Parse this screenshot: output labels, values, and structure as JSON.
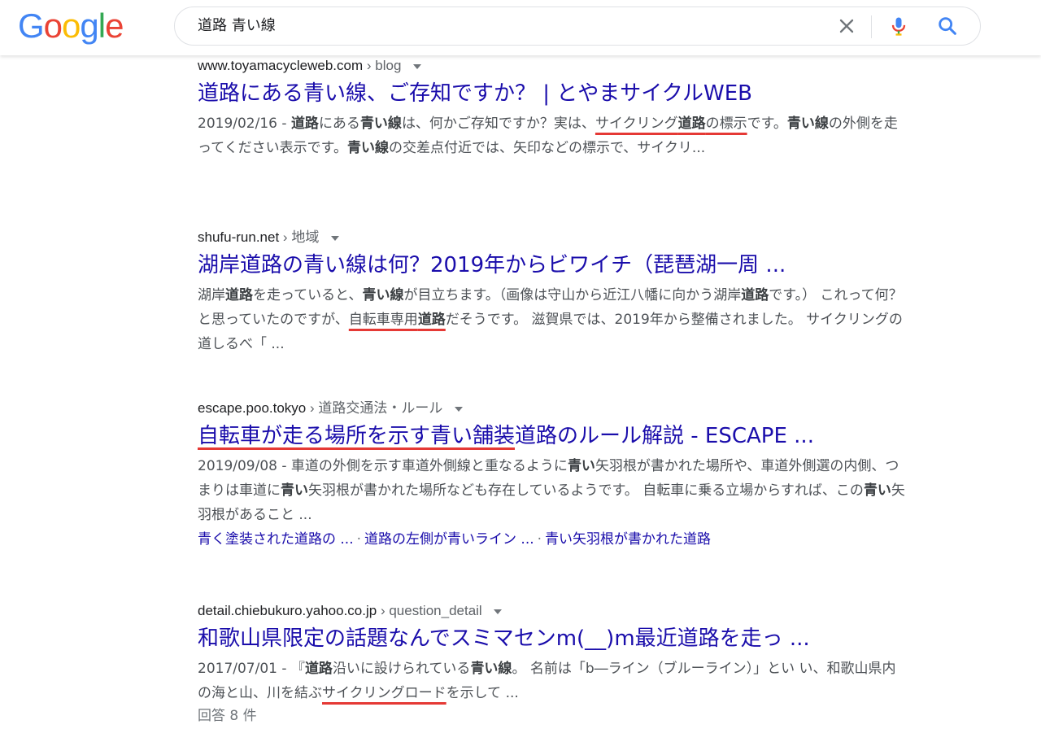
{
  "header": {
    "logo_letters": [
      {
        "ch": "G",
        "color": "#4285F4"
      },
      {
        "ch": "o",
        "color": "#EA4335"
      },
      {
        "ch": "o",
        "color": "#FBBC05"
      },
      {
        "ch": "g",
        "color": "#4285F4"
      },
      {
        "ch": "l",
        "color": "#34A853"
      },
      {
        "ch": "e",
        "color": "#EA4335"
      }
    ],
    "search_query": "道路 青い線",
    "icons": {
      "clear": "close-icon",
      "mic": "mic-icon",
      "search": "search-icon"
    }
  },
  "results": [
    {
      "domain": "www.toyamacycleweb.com",
      "crumb": "blog",
      "title": "道路にある青い線、ご存知ですか？ | とやまサイクルWEB",
      "snippet": [
        {
          "t": "2019/02/16 - "
        },
        {
          "t": "道路",
          "b": true
        },
        {
          "t": "にある"
        },
        {
          "t": "青い線",
          "b": true
        },
        {
          "t": "は、何かご存知ですか？実は、"
        },
        {
          "t": "サイクリング",
          "u": true
        },
        {
          "t": "道路",
          "b": true,
          "u": true
        },
        {
          "t": "の標示",
          "u": true
        },
        {
          "t": "です。"
        },
        {
          "t": "青い線",
          "b": true
        },
        {
          "t": "の外側を走ってください表示です。"
        },
        {
          "t": "青い線",
          "b": true
        },
        {
          "t": "の交差点付近では、矢印などの標示で、サイクリ..."
        }
      ]
    },
    {
      "domain": "shufu-run.net",
      "crumb": "地域",
      "title": "湖岸道路の青い線は何？2019年からビワイチ（琵琶湖一周 ...",
      "snippet": [
        {
          "t": "湖岸"
        },
        {
          "t": "道路",
          "b": true
        },
        {
          "t": "を走っていると、"
        },
        {
          "t": "青い線",
          "b": true
        },
        {
          "t": "が目立ちます。（画像は守山から近江八幡に向かう湖岸"
        },
        {
          "t": "道路",
          "b": true
        },
        {
          "t": "です。） これって何？と思っていたのですが、"
        },
        {
          "t": "自転車専用",
          "u": true
        },
        {
          "t": "道路",
          "b": true,
          "u": true
        },
        {
          "t": "だそうです。 滋賀県では、2019年から整備されました。 サイクリングの道しるべ「 ..."
        }
      ]
    },
    {
      "domain": "escape.poo.tokyo",
      "crumb": "道路交通法・ルール",
      "title_parts": [
        {
          "t": "自転車が走る場所を示す青い舗装",
          "u": true
        },
        {
          "t": "道路のルール解説 - ESCAPE ..."
        }
      ],
      "snippet": [
        {
          "t": "2019/09/08 - 車道の外側を示す車道外側線と重なるように"
        },
        {
          "t": "青い",
          "b": true
        },
        {
          "t": "矢羽根が書かれた場所や、車道外側選の内側、つまりは車道に"
        },
        {
          "t": "青い",
          "b": true
        },
        {
          "t": "矢羽根が書かれた場所なども存在しているようです。 自転車に乗る立場からすれば、この"
        },
        {
          "t": "青い",
          "b": true
        },
        {
          "t": "矢羽根があること ..."
        }
      ],
      "sitelinks": [
        "青く塗装された道路の ...",
        "道路の左側が青いライン ...",
        "青い矢羽根が書かれた道路"
      ]
    },
    {
      "domain": "detail.chiebukuro.yahoo.co.jp",
      "crumb": "question_detail",
      "title": "和歌山県限定の話題なんでスミマセンm(__)m最近道路を走っ ...",
      "snippet": [
        {
          "t": "2017/07/01 - 『"
        },
        {
          "t": "道路",
          "b": true
        },
        {
          "t": "沿いに設けられている"
        },
        {
          "t": "青い線",
          "b": true
        },
        {
          "t": "。 名前は「b―ライン（ブルーライン）」とい い、和歌山県内の海と山、川を結ぶ"
        },
        {
          "t": "サイクリングロード",
          "u": true
        },
        {
          "t": "を示して ..."
        }
      ],
      "answers": "回答 8 件"
    }
  ]
}
